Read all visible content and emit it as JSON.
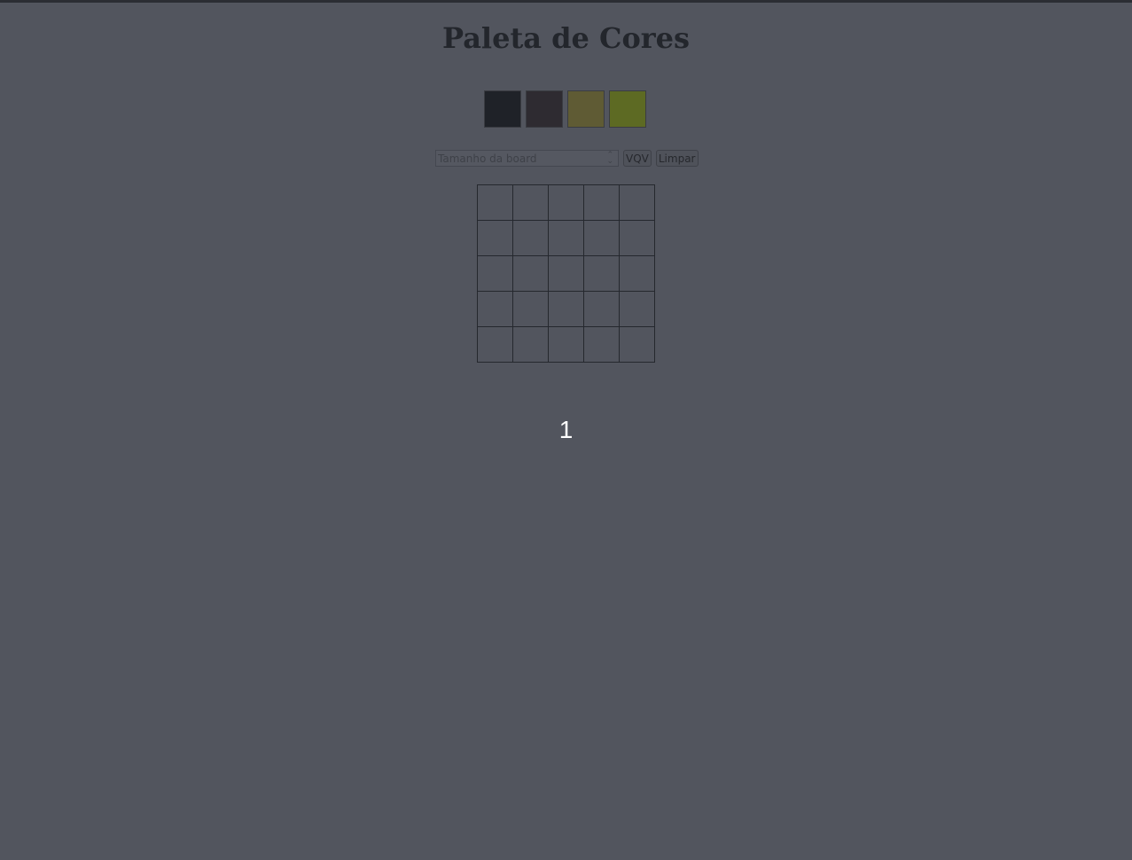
{
  "page": {
    "title": "Paleta de Cores"
  },
  "palette": {
    "colors": [
      "#1f2228",
      "#2e2b31",
      "#5f5b34",
      "#5d6a23"
    ]
  },
  "controls": {
    "board_size_placeholder": "Tamanho da board",
    "vqv_label": "VQV",
    "clear_label": "Limpar"
  },
  "board": {
    "rows": 5,
    "cols": 5
  },
  "counter": {
    "value": "1"
  },
  "colors": {
    "background": "#52555e",
    "grid_line": "#25282e",
    "title": "#23262c"
  }
}
